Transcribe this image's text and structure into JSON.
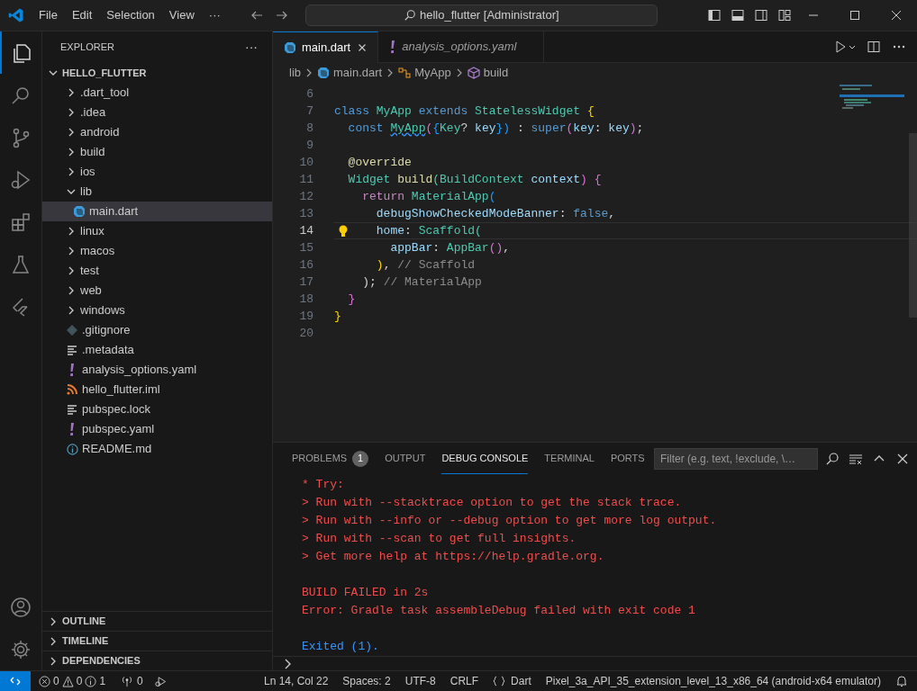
{
  "title_bar": {
    "menu": [
      "File",
      "Edit",
      "Selection",
      "View"
    ],
    "more": "···",
    "command_center": "hello_flutter [Administrator]"
  },
  "activity_bar": {
    "top": [
      {
        "kind": "explorer",
        "selected": true
      },
      {
        "kind": "search",
        "selected": false
      },
      {
        "kind": "source-control",
        "selected": false
      },
      {
        "kind": "run-debug",
        "selected": false
      },
      {
        "kind": "extensions",
        "selected": false
      },
      {
        "kind": "testing",
        "selected": false
      },
      {
        "kind": "flutter",
        "selected": false
      }
    ],
    "bottom": [
      {
        "kind": "account"
      },
      {
        "kind": "settings"
      }
    ]
  },
  "sidebar": {
    "title": "EXPLORER",
    "more": "···",
    "tree": [
      {
        "label": "HELLO_FLUTTER",
        "kind": "root",
        "expanded": true,
        "selected": false,
        "children": [
          {
            "label": ".dart_tool",
            "kind": "folder",
            "expanded": false,
            "selected": false
          },
          {
            "label": ".idea",
            "kind": "folder",
            "expanded": false,
            "selected": false
          },
          {
            "label": "android",
            "kind": "folder",
            "expanded": false,
            "selected": false
          },
          {
            "label": "build",
            "kind": "folder",
            "expanded": false,
            "selected": false
          },
          {
            "label": "ios",
            "kind": "folder",
            "expanded": false,
            "selected": false
          },
          {
            "label": "lib",
            "kind": "folder",
            "expanded": true,
            "selected": false,
            "children": [
              {
                "label": "main.dart",
                "kind": "dart",
                "selected": true
              }
            ]
          },
          {
            "label": "linux",
            "kind": "folder",
            "expanded": false,
            "selected": false
          },
          {
            "label": "macos",
            "kind": "folder",
            "expanded": false,
            "selected": false
          },
          {
            "label": "test",
            "kind": "folder",
            "expanded": false,
            "selected": false
          },
          {
            "label": "web",
            "kind": "folder",
            "expanded": false,
            "selected": false
          },
          {
            "label": "windows",
            "kind": "folder",
            "expanded": false,
            "selected": false
          },
          {
            "label": ".gitignore",
            "kind": "git",
            "selected": false
          },
          {
            "label": ".metadata",
            "kind": "text",
            "selected": false
          },
          {
            "label": "analysis_options.yaml",
            "kind": "yaml",
            "selected": false
          },
          {
            "label": "hello_flutter.iml",
            "kind": "feed",
            "selected": false
          },
          {
            "label": "pubspec.lock",
            "kind": "text",
            "selected": false
          },
          {
            "label": "pubspec.yaml",
            "kind": "yaml",
            "selected": false
          },
          {
            "label": "README.md",
            "kind": "info",
            "selected": false
          }
        ]
      }
    ],
    "sections": [
      {
        "label": "OUTLINE",
        "expanded": false
      },
      {
        "label": "TIMELINE",
        "expanded": false
      },
      {
        "label": "DEPENDENCIES",
        "expanded": false
      }
    ]
  },
  "editor": {
    "tabs": [
      {
        "label": "main.dart",
        "kind": "dart",
        "selected": true,
        "preview": false
      },
      {
        "label": "analysis_options.yaml",
        "kind": "yaml",
        "selected": false,
        "preview": true
      }
    ],
    "breadcrumbs": [
      {
        "label": "lib",
        "kind": "folder"
      },
      {
        "label": "main.dart",
        "kind": "dart"
      },
      {
        "label": "MyApp",
        "kind": "class"
      },
      {
        "label": "build",
        "kind": "method"
      }
    ],
    "lines": [
      {
        "number": "6",
        "current": false,
        "lightbulb": false
      },
      {
        "number": "7",
        "current": false,
        "lightbulb": false,
        "tokens": [
          {
            "t": "class ",
            "color": "#569cd6"
          },
          {
            "t": "MyApp ",
            "color": "#4ec9b0"
          },
          {
            "t": "extends ",
            "color": "#569cd6"
          },
          {
            "t": "StatelessWidget ",
            "color": "#4ec9b0"
          },
          {
            "t": "{",
            "color": "#ffd700"
          }
        ]
      },
      {
        "number": "8",
        "current": false,
        "lightbulb": false,
        "tokens": [
          {
            "t": "  const ",
            "color": "#569cd6"
          },
          {
            "t": "MyApp",
            "color": "#4ec9b0",
            "squiggle": true
          },
          {
            "t": "(",
            "color": "#da70d6"
          },
          {
            "t": "{",
            "color": "#179fff"
          },
          {
            "t": "Key",
            "color": "#4ec9b0"
          },
          {
            "t": "? ",
            "color": "#d4d4d4"
          },
          {
            "t": "key",
            "color": "#9cdcfe"
          },
          {
            "t": "})",
            "color": "#179fff"
          },
          {
            "t": " : "
          },
          {
            "t": "super",
            "color": "#569cd6"
          },
          {
            "t": "(",
            "color": "#da70d6"
          },
          {
            "t": "key",
            "color": "#9cdcfe"
          },
          {
            "t": ": "
          },
          {
            "t": "key",
            "color": "#9cdcfe"
          },
          {
            "t": ")",
            "color": "#da70d6"
          },
          {
            "t": ";"
          }
        ]
      },
      {
        "number": "9",
        "current": false,
        "lightbulb": false
      },
      {
        "number": "10",
        "current": false,
        "lightbulb": false,
        "tokens": [
          {
            "t": "  @override",
            "color": "#dcdcaa"
          }
        ]
      },
      {
        "number": "11",
        "current": false,
        "lightbulb": false,
        "tokens": [
          {
            "t": "  Widget ",
            "color": "#4ec9b0"
          },
          {
            "t": "build",
            "color": "#dcdcaa"
          },
          {
            "t": "(BuildContext ",
            "color": "#4ec9b0"
          },
          {
            "t": "context",
            "color": "#9cdcfe"
          },
          {
            "t": ") {",
            "color": "#da70d6"
          }
        ]
      },
      {
        "number": "12",
        "current": false,
        "lightbulb": false,
        "tokens": [
          {
            "t": "    return ",
            "color": "#c586c0"
          },
          {
            "t": "MaterialApp",
            "color": "#4ec9b0"
          },
          {
            "t": "(",
            "color": "#179fff"
          }
        ]
      },
      {
        "number": "13",
        "current": false,
        "lightbulb": false,
        "tokens": [
          {
            "t": "      debugShowCheckedModeBanner",
            "color": "#9cdcfe"
          },
          {
            "t": ": "
          },
          {
            "t": "false",
            "color": "#569cd6"
          },
          {
            "t": ","
          }
        ]
      },
      {
        "number": "14",
        "current": true,
        "lightbulb": true,
        "tokens": [
          {
            "t": "      home",
            "color": "#9cdcfe"
          },
          {
            "t": ": "
          },
          {
            "t": "Scaffold(",
            "color": "#4ec9b0"
          }
        ]
      },
      {
        "number": "15",
        "current": false,
        "lightbulb": false,
        "tokens": [
          {
            "t": "        appBar",
            "color": "#9cdcfe"
          },
          {
            "t": ": "
          },
          {
            "t": "AppBar",
            "color": "#4ec9b0"
          },
          {
            "t": "()",
            "color": "#da70d6"
          },
          {
            "t": ","
          }
        ]
      },
      {
        "number": "16",
        "current": false,
        "lightbulb": false,
        "tokens": [
          {
            "t": "      )",
            "color": "#ffd700"
          },
          {
            "t": ", "
          },
          {
            "t": "// Scaffold",
            "color": "#8b8b8b"
          }
        ]
      },
      {
        "number": "17",
        "current": false,
        "lightbulb": false,
        "tokens": [
          {
            "t": "    ); "
          },
          {
            "t": "// MaterialApp",
            "color": "#8b8b8b"
          }
        ]
      },
      {
        "number": "18",
        "current": false,
        "lightbulb": false,
        "tokens": [
          {
            "t": "  }",
            "color": "#da70d6"
          }
        ]
      },
      {
        "number": "19",
        "current": false,
        "lightbulb": false,
        "tokens": [
          {
            "t": "}",
            "color": "#ffd700"
          }
        ]
      },
      {
        "number": "20",
        "current": false,
        "lightbulb": false
      }
    ]
  },
  "panel": {
    "tabs": [
      {
        "label": "PROBLEMS",
        "badge": "1",
        "selected": false
      },
      {
        "label": "OUTPUT",
        "selected": false
      },
      {
        "label": "DEBUG CONSOLE",
        "selected": true
      },
      {
        "label": "TERMINAL",
        "selected": false
      },
      {
        "label": "PORTS",
        "selected": false
      }
    ],
    "filter": {
      "placeholder": "Filter (e.g. text, !exclude, \\…"
    },
    "console": [
      {
        "text": "* Try:",
        "kind": "error"
      },
      {
        "text": "> Run with --stacktrace option to get the stack trace.",
        "kind": "error"
      },
      {
        "text": "> Run with --info or --debug option to get more log output.",
        "kind": "error"
      },
      {
        "text": "> Run with --scan to get full insights.",
        "kind": "error"
      },
      {
        "text": "> Get more help at https://help.gradle.org.",
        "kind": "error"
      },
      {
        "kind": "blank"
      },
      {
        "text": "BUILD FAILED in 2s",
        "kind": "error"
      },
      {
        "text": "Error: Gradle task assembleDebug failed with exit code 1",
        "kind": "error"
      },
      {
        "kind": "blank"
      },
      {
        "text": "Exited (1).",
        "kind": "info"
      }
    ]
  },
  "status_bar": {
    "errors": "0",
    "warnings": "0",
    "infos": "1",
    "ports": "0",
    "position": "Ln 14, Col 22",
    "indent": "Spaces: 2",
    "encoding": "UTF-8",
    "eol": "CRLF",
    "language": "Dart",
    "device": "Pixel_3a_API_35_extension_level_13_x86_64 (android-x64 emulator)"
  }
}
